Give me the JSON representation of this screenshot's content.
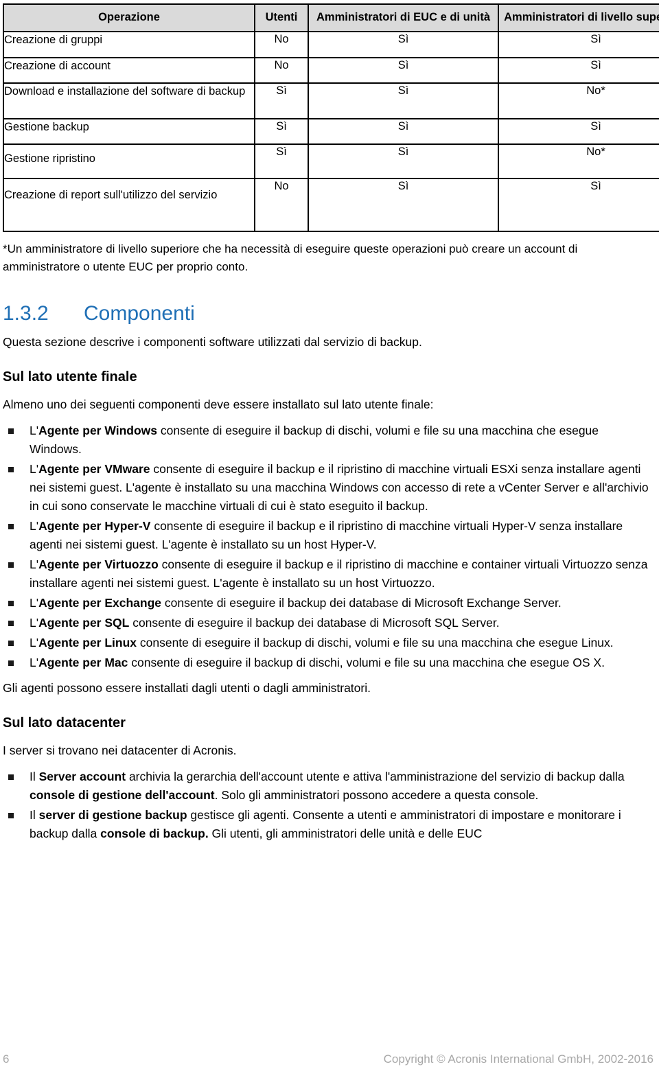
{
  "table": {
    "headers": [
      "Operazione",
      "Utenti",
      "Amministratori di EUC e di unità",
      "Amministratori di livello superiore"
    ],
    "rows": [
      {
        "operation": "Creazione di gruppi",
        "users": "No",
        "euc_admins": "Sì",
        "upper_admins": "Sì"
      },
      {
        "operation": "Creazione di account",
        "users": "No",
        "euc_admins": "Sì",
        "upper_admins": "Sì"
      },
      {
        "operation": "Download e installazione del software di backup",
        "users": "Sì",
        "euc_admins": "Sì",
        "upper_admins": "No*"
      },
      {
        "operation": "Gestione backup",
        "users": "Sì",
        "euc_admins": "Sì",
        "upper_admins": "Sì"
      },
      {
        "operation": "Gestione ripristino",
        "users": "Sì",
        "euc_admins": "Sì",
        "upper_admins": "No*"
      },
      {
        "operation": "Creazione di report sull'utilizzo del servizio",
        "users": "No",
        "euc_admins": "Sì",
        "upper_admins": "Sì"
      }
    ]
  },
  "footnote": "*Un amministratore di livello superiore che ha necessità di eseguire queste operazioni può creare un account di amministratore o utente EUC per proprio conto.",
  "section": {
    "number": "1.3.2",
    "title": "Componenti",
    "intro": "Questa sezione descrive i componenti software utilizzati dal servizio di backup."
  },
  "end_user": {
    "heading": "Sul lato utente finale",
    "lead": "Almeno uno dei seguenti componenti deve essere installato sul lato utente finale:",
    "items": [
      {
        "prefix": "L'",
        "bold": "Agente per Windows",
        "rest": " consente di eseguire il backup di dischi, volumi e file su una macchina che esegue Windows."
      },
      {
        "prefix": "L'",
        "bold": "Agente per VMware",
        "rest": " consente di eseguire il backup e il ripristino di macchine virtuali ESXi senza installare agenti nei sistemi guest. L'agente è installato su una macchina Windows con accesso di rete a vCenter Server e all'archivio in cui sono conservate le macchine virtuali di cui è stato eseguito il backup."
      },
      {
        "prefix": "L'",
        "bold": "Agente per Hyper-V",
        "rest": " consente di eseguire il backup e il ripristino di macchine virtuali Hyper-V senza installare agenti nei sistemi guest. L'agente è installato su un host Hyper-V."
      },
      {
        "prefix": "L'",
        "bold": "Agente per Virtuozzo",
        "rest": " consente di eseguire il backup e il ripristino di macchine e container virtuali Virtuozzo senza installare agenti nei sistemi guest. L'agente è installato su un host Virtuozzo."
      },
      {
        "prefix": "L'",
        "bold": "Agente per Exchange",
        "rest": " consente di eseguire il backup dei database di Microsoft Exchange Server."
      },
      {
        "prefix": "L'",
        "bold": "Agente per SQL",
        "rest": " consente di eseguire il backup dei database di Microsoft SQL Server."
      },
      {
        "prefix": "L'",
        "bold": "Agente per Linux",
        "rest": " consente di eseguire il backup di dischi, volumi e file su una macchina che esegue Linux."
      },
      {
        "prefix": "L'",
        "bold": "Agente per Mac",
        "rest": " consente di eseguire il backup di dischi, volumi e file su una macchina che esegue OS X."
      }
    ],
    "closing": "Gli agenti possono essere installati dagli utenti o dagli amministratori."
  },
  "datacenter": {
    "heading": "Sul lato datacenter",
    "lead": "I server si trovano nei datacenter di Acronis.",
    "items": [
      {
        "p1": "Il ",
        "b1": "Server account",
        "p2": " archivia la gerarchia dell'account utente e attiva l'amministrazione del servizio di backup dalla ",
        "b2": "console di gestione dell'account",
        "p3": ". Solo gli amministratori possono accedere a questa console."
      },
      {
        "p1": "Il ",
        "b1": "server di gestione backup",
        "p2": " gestisce gli agenti. Consente a utenti e amministratori di impostare e monitorare i backup dalla ",
        "b2": "console di backup.",
        "p3": " Gli utenti, gli amministratori delle unità e delle EUC"
      }
    ]
  },
  "footer": {
    "page_number": "6",
    "copyright": "Copyright © Acronis International GmbH, 2002-2016"
  },
  "colors": {
    "heading_blue": "#1f6fb5",
    "table_header_bg": "#dadada",
    "footer_gray": "#a8a8a8",
    "bullet": "#1a1a1a"
  }
}
